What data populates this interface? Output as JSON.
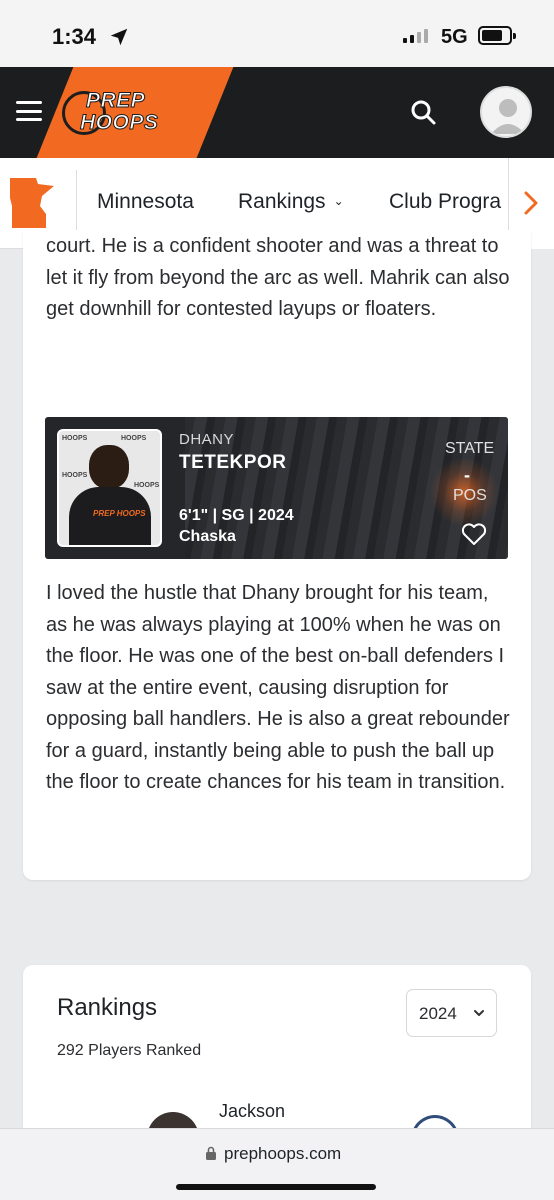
{
  "status_bar": {
    "time": "1:34",
    "network": "5G"
  },
  "header": {
    "logo_line1": "PREP",
    "logo_line2": "HOOPS",
    "accent_color": "#f26a21"
  },
  "subnav": {
    "items": [
      {
        "label": "Minnesota"
      },
      {
        "label": "Rankings"
      },
      {
        "label": "Club Progra"
      }
    ]
  },
  "article": {
    "para1": "court. He is a confident shooter and was a threat to let it fly from beyond the arc as well. Mahrik can also get downhill for contested layups or floaters.",
    "para2": "I loved the hustle that Dhany brought for his team, as he was always playing at 100% when he was on the floor. He was one of the best on-ball defenders I saw at the entire event, causing disruption for opposing ball handlers. He is also a great rebounder for a guard, instantly being able to push the ball up the floor to create chances for his team in transition."
  },
  "player_card": {
    "first_name": "DHANY",
    "last_name": "TETEKPOR",
    "meta": "6'1\" | SG | 2024",
    "school": "Chaska",
    "state_label": "STATE",
    "rank_value": "-",
    "pos_label": "POS",
    "photo_backdrop_text": "HOOPS",
    "photo_shirt_text": "PREP HOOPS"
  },
  "rankings": {
    "title": "Rankings",
    "count": "292 Players Ranked",
    "year": "2024",
    "first_player": "Jackson"
  },
  "url_bar": {
    "url": "prephoops.com"
  }
}
